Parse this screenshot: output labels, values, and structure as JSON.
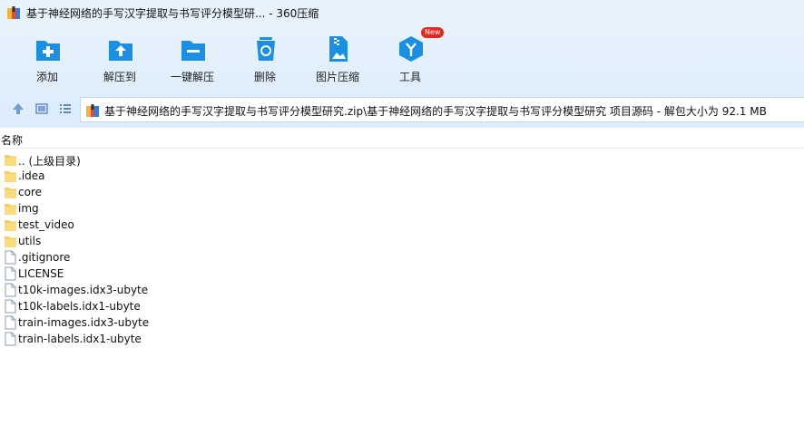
{
  "window": {
    "title": "基于神经网络的手写汉字提取与书写评分模型研... - 360压缩",
    "app_icon": "archive-icon"
  },
  "toolbar": [
    {
      "id": "add",
      "label": "添加",
      "icon": "add-file-icon"
    },
    {
      "id": "extract-to",
      "label": "解压到",
      "icon": "extract-folder-icon"
    },
    {
      "id": "one-click-extract",
      "label": "一键解压",
      "icon": "one-click-folder-icon"
    },
    {
      "id": "delete",
      "label": "删除",
      "icon": "recycle-bin-icon"
    },
    {
      "id": "image-compress",
      "label": "图片压缩",
      "icon": "image-zip-icon"
    },
    {
      "id": "tools",
      "label": "工具",
      "icon": "tools-cube-icon",
      "badge": "New"
    }
  ],
  "address": {
    "path": "基于神经网络的手写汉字提取与书写评分模型研究.zip\\基于神经网络的手写汉字提取与书写评分模型研究 项目源码 - 解包大小为 92.1 MB"
  },
  "list": {
    "column_name": "名称",
    "items": [
      {
        "name": ".. (上级目录)",
        "kind": "folder"
      },
      {
        "name": ".idea",
        "kind": "folder"
      },
      {
        "name": "core",
        "kind": "folder"
      },
      {
        "name": "img",
        "kind": "folder"
      },
      {
        "name": "test_video",
        "kind": "folder"
      },
      {
        "name": "utils",
        "kind": "folder"
      },
      {
        "name": ".gitignore",
        "kind": "file"
      },
      {
        "name": "LICENSE",
        "kind": "file"
      },
      {
        "name": "t10k-images.idx3-ubyte",
        "kind": "file"
      },
      {
        "name": "t10k-labels.idx1-ubyte",
        "kind": "file"
      },
      {
        "name": "train-images.idx3-ubyte",
        "kind": "file"
      },
      {
        "name": "train-labels.idx1-ubyte",
        "kind": "file"
      }
    ]
  },
  "colors": {
    "accent": "#1a8fe3",
    "folder": "#f7cf58",
    "badge": "#e5281f"
  }
}
